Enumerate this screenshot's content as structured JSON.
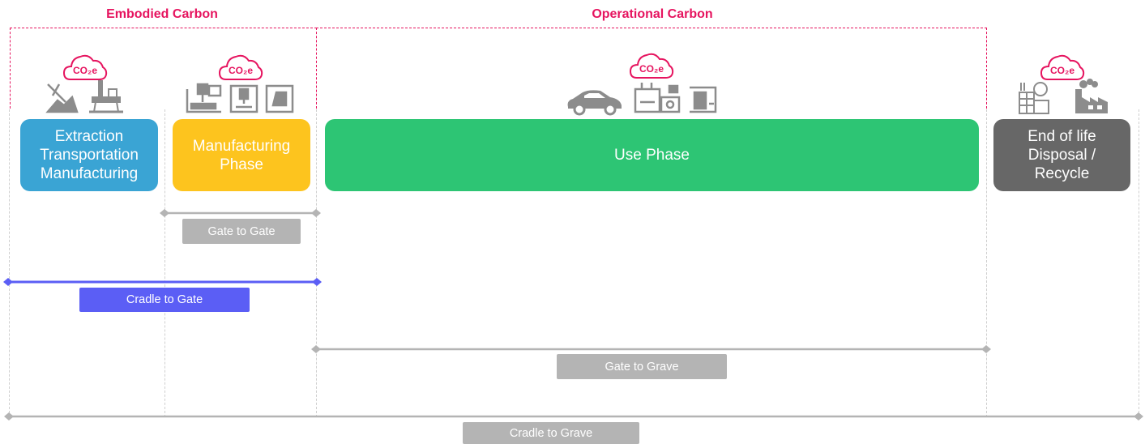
{
  "groups": {
    "embodied": "Embodied Carbon",
    "operational": "Operational Carbon"
  },
  "co2_label": "CO₂e",
  "phases": {
    "extraction": [
      "Extraction",
      "Transportation",
      "Manufacturing"
    ],
    "manufacturing": [
      "Manufacturing",
      "Phase"
    ],
    "use": [
      "Use Phase"
    ],
    "eol": [
      "End of life",
      "Disposal /",
      "Recycle"
    ]
  },
  "scopes": {
    "gate_to_gate": "Gate to Gate",
    "cradle_to_gate": "Cradle to Gate",
    "gate_to_grave": "Gate to Grave",
    "cradle_to_grave": "Cradle to Grave"
  },
  "colors": {
    "accent": "#e6145f",
    "extraction": "#3aa4d4",
    "manufacturing": "#fdc41e",
    "use": "#2dc574",
    "eol": "#676767",
    "scope_gray": "#b4b4b4",
    "scope_blue": "#5b5ef5"
  },
  "icons": {
    "extraction": [
      "mining-icon",
      "oil-rig-icon"
    ],
    "manufacturing": [
      "cnc-machine-icon",
      "3d-printer-icon",
      "press-machine-icon"
    ],
    "use": [
      "car-icon",
      "generator-icon",
      "coffee-machine-icon"
    ],
    "eol": [
      "recycling-facility-icon",
      "factory-icon"
    ]
  }
}
